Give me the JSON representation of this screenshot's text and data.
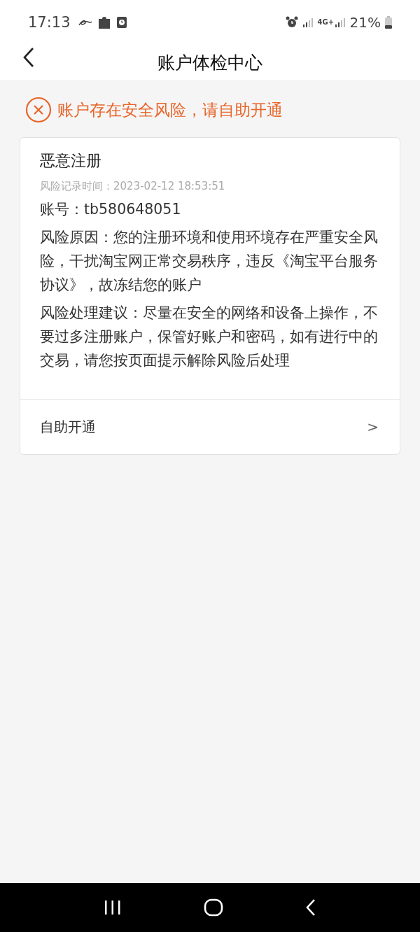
{
  "status_bar": {
    "time": "17:13",
    "network": "4G+",
    "battery": "21%"
  },
  "header": {
    "title": "账户体检中心"
  },
  "alert": {
    "text": "账户存在安全风险，请自助开通"
  },
  "card": {
    "title": "恶意注册",
    "record_time": "风险记录时间：2023-02-12 18:53:51",
    "lines": [
      "账号：tb580648051",
      "风险原因：您的注册环境和使用环境存在严重安全风险，干扰淘宝网正常交易秩序，违反《淘宝平台服务协议》，故冻结您的账户",
      "风险处理建议：尽量在安全的网络和设备上操作，不要过多注册账户，保管好账户和密码，如有进行中的交易，请您按页面提示解除风险后处理"
    ],
    "action": {
      "label": "自助开通",
      "arrow": ">"
    }
  }
}
